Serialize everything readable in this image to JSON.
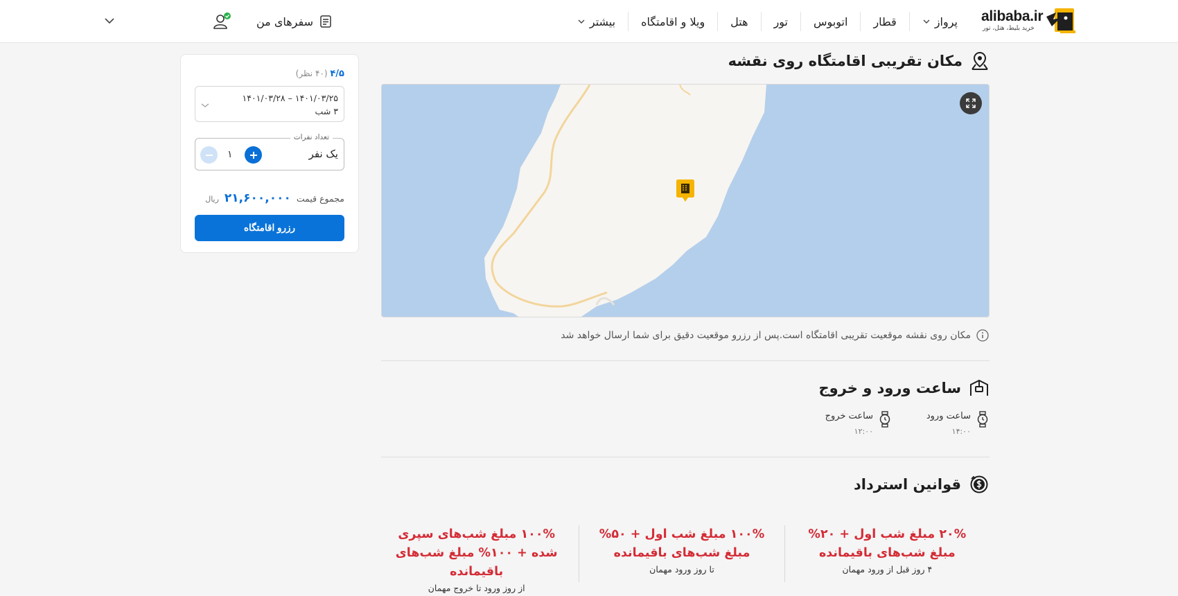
{
  "header": {
    "logo": {
      "text": "alibaba.ir",
      "tagline": "خرید بلیط، هتل، تور"
    },
    "nav": [
      {
        "label": "پرواز",
        "has_dropdown": true
      },
      {
        "label": "قطار",
        "has_dropdown": false
      },
      {
        "label": "اتوبوس",
        "has_dropdown": false
      },
      {
        "label": "تور",
        "has_dropdown": false
      },
      {
        "label": "هتل",
        "has_dropdown": false
      },
      {
        "label": "ویلا و اقامتگاه",
        "has_dropdown": false
      },
      {
        "label": "بیشتر",
        "has_dropdown": true
      }
    ],
    "my_trips": "سفرهای من"
  },
  "booking": {
    "rating": "۴/۵",
    "rating_count": "(۴۰ نظر)",
    "date_range": "۱۴۰۱/۰۳/۲۵ – ۱۴۰۱/۰۳/۲۸",
    "nights": "۳ شب",
    "people_legend": "تعداد نفرات",
    "people_value": "یک نفر",
    "people_count": "۱",
    "total_label": "مجموع قیمت",
    "total_amount": "۲۱,۶۰۰,۰۰۰",
    "total_unit": "ریال",
    "book_button": "رزرو اقامتگاه"
  },
  "location": {
    "title": "مکان تقریبی اقامتگاه روی نقشه",
    "note": "مکان روی نقشه موقعیت تقریبی اقامتگاه است.پس از رزرو موقعیت دقیق برای شما ارسال خواهد شد"
  },
  "checkin": {
    "title": "ساعت ورود و خروج",
    "in_label": "ساعت ورود",
    "in_time": "۱۴:۰۰",
    "out_label": "ساعت خروج",
    "out_time": "۱۲:۰۰"
  },
  "refund": {
    "title": "قوانین استرداد",
    "rules": [
      {
        "title": "۲۰% مبلغ شب اول + ۲۰% مبلغ شب‌های باقیمانده",
        "sub": "۴ روز قبل از ورود مهمان"
      },
      {
        "title": "۱۰۰% مبلغ شب اول + ۵۰% مبلغ شب‌های باقیمانده",
        "sub": "تا روز ورود مهمان"
      },
      {
        "title": "۱۰۰% مبلغ شب‌های سپری شده + ۱۰۰% مبلغ شب‌های باقیمانده",
        "sub": "از روز ورود تا خروج مهمان"
      }
    ]
  },
  "colors": {
    "primary": "#0a73d9",
    "refund_red": "#d42c36",
    "map_water": "#b4cfeb",
    "map_land": "#f7f5f1",
    "marker": "#f5b400"
  }
}
